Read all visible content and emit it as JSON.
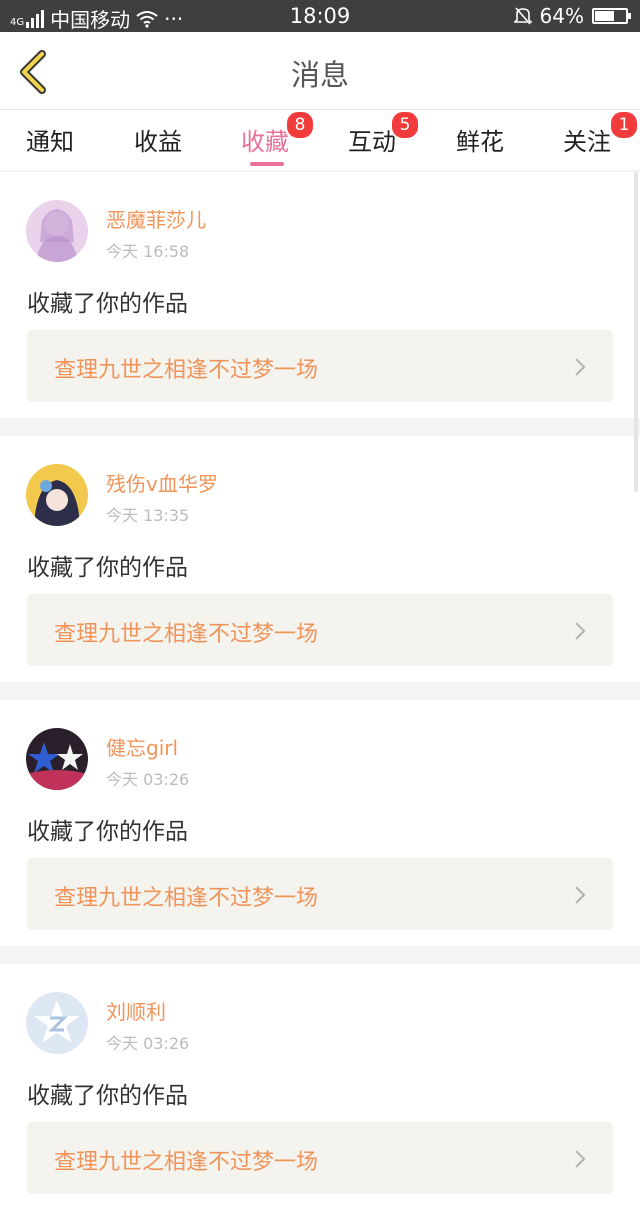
{
  "status_bar": {
    "network": "4G",
    "carrier": "中国移动",
    "dots": "···",
    "time": "18:09",
    "battery_text": "64%",
    "battery_level": 0.64
  },
  "header": {
    "title": "消息",
    "back_icon": "chevron-left-icon"
  },
  "tabs": [
    {
      "label": "通知",
      "badge": ""
    },
    {
      "label": "收益",
      "badge": ""
    },
    {
      "label": "收藏",
      "badge": "8"
    },
    {
      "label": "互动",
      "badge": "5"
    },
    {
      "label": "鲜花",
      "badge": ""
    },
    {
      "label": "关注",
      "badge": "1"
    }
  ],
  "messages": [
    {
      "user": "恶魔菲莎儿",
      "time": "今天 16:58",
      "action": "收藏了你的作品",
      "work": "查理九世之相逢不过梦一场"
    },
    {
      "user": "残伤v血华罗",
      "time": "今天 13:35",
      "action": "收藏了你的作品",
      "work": "查理九世之相逢不过梦一场"
    },
    {
      "user": "健忘girl",
      "time": "今天 03:26",
      "action": "收藏了你的作品",
      "work": "查理九世之相逢不过梦一场"
    },
    {
      "user": "刘顺利",
      "time": "今天 03:26",
      "action": "收藏了你的作品",
      "work": "查理九世之相逢不过梦一场"
    }
  ],
  "colors": {
    "accent": "#e9719b",
    "badge": "#f23c3c",
    "username": "#f0945a"
  }
}
